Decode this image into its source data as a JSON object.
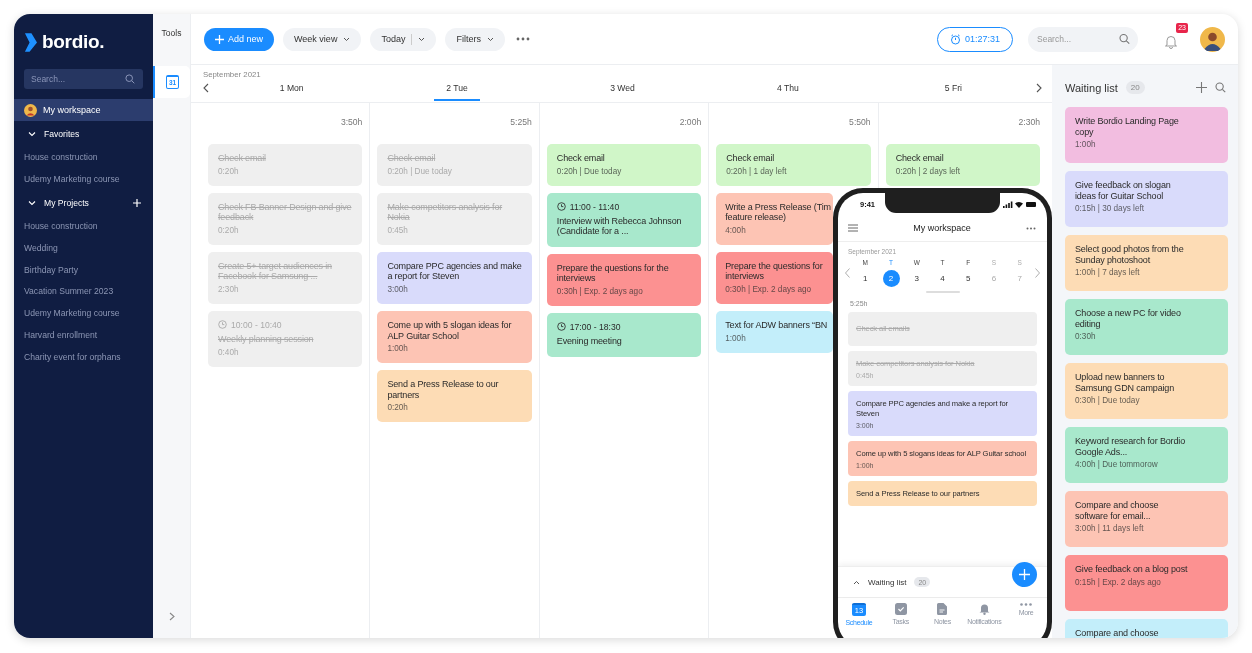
{
  "sidebar": {
    "logo": "bordio.",
    "search": {
      "placeholder": "Search..."
    },
    "workspace": {
      "label": "My workspace",
      "selected": true
    },
    "groups": [
      {
        "label": "Favorites",
        "expanded": true,
        "can_add": false,
        "items": [
          {
            "label": "House construction",
            "selected": false
          },
          {
            "label": "Udemy Marketing course",
            "selected": false
          }
        ]
      },
      {
        "label": "My Projects",
        "expanded": true,
        "can_add": true,
        "items": [
          {
            "label": "House construction",
            "selected": false
          },
          {
            "label": "Wedding",
            "selected": false
          },
          {
            "label": "Birthday Party",
            "selected": false
          },
          {
            "label": "Vacation Summer 2023",
            "selected": false
          },
          {
            "label": "Udemy Marketing course",
            "selected": false
          },
          {
            "label": "Harvard enrollment",
            "selected": false
          },
          {
            "label": "Charity event for orphans",
            "selected": false
          }
        ]
      }
    ]
  },
  "tools": {
    "label": "Tools",
    "items": [
      {
        "kind": "calendar",
        "icon_text": "31",
        "selected": true
      }
    ]
  },
  "toolbar": {
    "add_new": "Add new",
    "view": "Week view",
    "today": "Today",
    "filters": "Filters",
    "timer": "01:27:31",
    "search": {
      "placeholder": "Search..."
    },
    "notifications": "23"
  },
  "calendar": {
    "month": "September 2021",
    "days": [
      {
        "label": "1 Mon",
        "selected": false,
        "total": "3:50h",
        "cards": [
          {
            "title": "Check email",
            "meta": "0:20h",
            "done": true,
            "color": "#efefef"
          },
          {
            "title": "Check FB Banner Design and give feedback",
            "meta": "0:20h",
            "done": true,
            "color": "#efefef"
          },
          {
            "title": "Create 5+ target audiences in Facebook for Samsung ...",
            "meta": "2:30h",
            "done": true,
            "color": "#efefef"
          },
          {
            "time": "10:00 - 10:40",
            "title": "Weekly planning session",
            "meta": "0:40h",
            "done": true,
            "color": "#efefef"
          }
        ]
      },
      {
        "label": "2 Tue",
        "selected": true,
        "total": "5:25h",
        "cards": [
          {
            "title": "Check email",
            "meta": "0:20h | Due today",
            "done": true,
            "color": "#efefef"
          },
          {
            "title": "Make competitors analysis for Nokia",
            "meta": "0:45h",
            "done": true,
            "color": "#efefef"
          },
          {
            "title": "Compare PPC agencies and make a report for Steven",
            "meta": "3:00h",
            "done": false,
            "color": "#d9dbfb"
          },
          {
            "title": "Come up with 5 slogan ideas for ALP Guitar School",
            "meta": "1:00h",
            "done": false,
            "color": "#fdc4b4"
          },
          {
            "title": "Send a Press Release to our partners",
            "meta": "0:20h",
            "done": false,
            "color": "#fddcb5"
          }
        ]
      },
      {
        "label": "3 Wed",
        "selected": false,
        "total": "2:00h",
        "cards": [
          {
            "title": "Check email",
            "meta": "0:20h | Due today",
            "done": false,
            "color": "#d0f6c8"
          },
          {
            "time": "11:00 - 11:40",
            "title": "Interview with Rebecca Johnson (Candidate for a ...",
            "done": false,
            "color": "#a8e8cc"
          },
          {
            "title": "Prepare the questions for the interviews",
            "meta": "0:30h | Exp. 2 days ago",
            "done": false,
            "color": "#fc9191"
          },
          {
            "time": "17:00 - 18:30",
            "title": "Evening meeting",
            "done": false,
            "color": "#a8e8cc"
          }
        ]
      },
      {
        "label": "4 Thu",
        "selected": false,
        "total": "5:50h",
        "cards": [
          {
            "title": "Check email",
            "meta": "0:20h | 1 day left",
            "done": false,
            "color": "#d0f6c8"
          },
          {
            "title": "Write a Press Release (Tim\nfeature release)",
            "meta": "4:00h",
            "done": false,
            "color": "#fdc4b4"
          },
          {
            "title": "Prepare the questions for\ninterviews",
            "meta": "0:30h | Exp. 2 days ago",
            "done": false,
            "color": "#fc9191"
          },
          {
            "title": "Text for ADW banners “BN",
            "meta": "1:00h",
            "done": false,
            "color": "#c3eefa"
          }
        ]
      },
      {
        "label": "5 Fri",
        "selected": false,
        "total": "2:30h",
        "cards": [
          {
            "title": "Check email",
            "meta": "0:20h | 2 days left",
            "done": false,
            "color": "#d0f6c8"
          }
        ]
      }
    ]
  },
  "waiting_list": {
    "title": "Waiting list",
    "count": "20",
    "items": [
      {
        "title": "Write Bordio Landing Page copy",
        "meta": "1:00h",
        "color": "#f2bde0"
      },
      {
        "title": "Give feedback on slogan ideas for Guitar School",
        "meta": "0:15h | 30 days left",
        "color": "#d9dbfb"
      },
      {
        "title": "Select good photos from the Sunday photoshoot",
        "meta": "1:00h | 7 days left",
        "color": "#fddcb5"
      },
      {
        "title": "Choose a new PC for video editing",
        "meta": "0:30h",
        "color": "#a8e8cc"
      },
      {
        "title": "Upload new banners to Samsung GDN campaign",
        "meta": "0:30h | Due today",
        "color": "#fddcb5"
      },
      {
        "title": "Keyword research for Bordio Google Ads...",
        "meta": "4:00h | Due tommorow",
        "color": "#a8e8cc"
      },
      {
        "title": "Compare and choose software for email...",
        "meta": "3:00h | 11 days left",
        "color": "#fdc4b4"
      },
      {
        "title": "Give feedback on a blog post",
        "meta": "0:15h | Exp. 2 days ago",
        "color": "#fc9191"
      },
      {
        "title": "Compare and choose",
        "color": "#c3eefa"
      }
    ]
  },
  "phone": {
    "time": "9:41",
    "title": "My workspace",
    "month": "September 2021",
    "total": "5:25h",
    "days": [
      {
        "letter": "M",
        "number": "1",
        "selected": false,
        "weekend": false
      },
      {
        "letter": "T",
        "number": "2",
        "selected": true,
        "weekend": false
      },
      {
        "letter": "W",
        "number": "3",
        "selected": false,
        "weekend": false
      },
      {
        "letter": "T",
        "number": "4",
        "selected": false,
        "weekend": false
      },
      {
        "letter": "F",
        "number": "5",
        "selected": false,
        "weekend": false
      },
      {
        "letter": "S",
        "number": "6",
        "selected": false,
        "weekend": true
      },
      {
        "letter": "S",
        "number": "7",
        "selected": false,
        "weekend": true
      }
    ],
    "tasks": [
      {
        "title": "Check all emails",
        "done": true,
        "color": "#efefef"
      },
      {
        "title": "Make competitors analysis for Nokia",
        "meta": "0:45h",
        "done": true,
        "color": "#efefef"
      },
      {
        "title": "Compare PPC agencies and make a report for Steven",
        "meta": "3:00h",
        "done": false,
        "color": "#d9dbfb"
      },
      {
        "title": "Come up with 5 slogans ideas for ALP Guitar school",
        "meta": "1:00h",
        "done": false,
        "color": "#fdc4b4"
      },
      {
        "title": "Send a Press Release to our partners",
        "done": false,
        "color": "#fddcb5"
      }
    ],
    "waiting": {
      "label": "Waiting list",
      "count": "20"
    },
    "tabs": [
      {
        "kind": "schedule",
        "label": "Schedule",
        "icon_text": "13",
        "selected": true
      },
      {
        "kind": "tasks",
        "label": "Tasks",
        "selected": false
      },
      {
        "kind": "notes",
        "label": "Notes",
        "selected": false
      },
      {
        "kind": "notifications",
        "label": "Notifications",
        "selected": false
      },
      {
        "kind": "more",
        "label": "More",
        "selected": false
      }
    ]
  }
}
